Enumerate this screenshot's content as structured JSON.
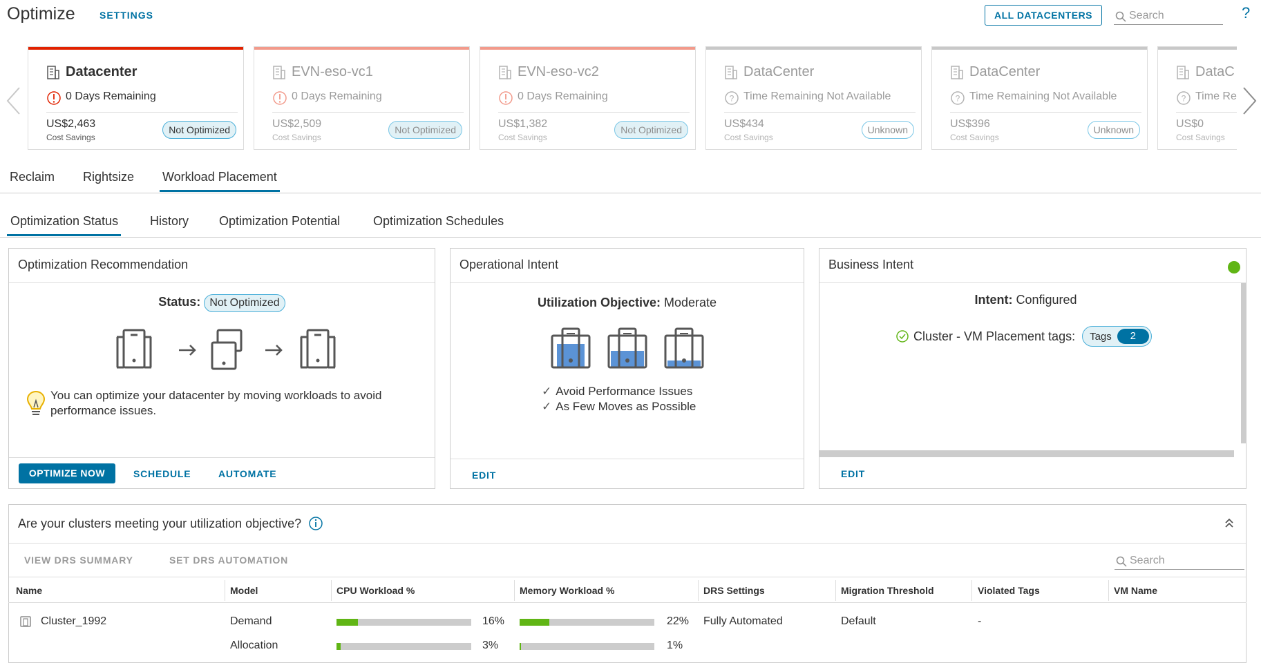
{
  "header": {
    "title": "Optimize",
    "settings_label": "SETTINGS",
    "all_datacenters_label": "ALL DATACENTERS",
    "search_placeholder": "Search",
    "help_label": "?"
  },
  "carousel": {
    "cards": [
      {
        "name": "Datacenter",
        "remaining": "0 Days Remaining",
        "amount": "US$2,463",
        "savings_label": "Cost Savings",
        "badge": "Not Optimized",
        "state": "active",
        "alert": "error"
      },
      {
        "name": "EVN-eso-vc1",
        "remaining": "0 Days Remaining",
        "amount": "US$2,509",
        "savings_label": "Cost Savings",
        "badge": "Not Optimized",
        "state": "dim",
        "alert": "error"
      },
      {
        "name": "EVN-eso-vc2",
        "remaining": "0 Days Remaining",
        "amount": "US$1,382",
        "savings_label": "Cost Savings",
        "badge": "Not Optimized",
        "state": "dim",
        "alert": "error"
      },
      {
        "name": "DataCenter",
        "remaining": "Time Remaining Not Available",
        "amount": "US$434",
        "savings_label": "Cost Savings",
        "badge": "Unknown",
        "state": "dim",
        "alert": "unknown"
      },
      {
        "name": "DataCenter",
        "remaining": "Time Remaining Not Available",
        "amount": "US$396",
        "savings_label": "Cost Savings",
        "badge": "Unknown",
        "state": "dim",
        "alert": "unknown"
      },
      {
        "name": "DataC",
        "remaining": "Time Re",
        "amount": "US$0",
        "savings_label": "Cost Savings",
        "badge": "",
        "state": "dim",
        "alert": "unknown"
      }
    ]
  },
  "tabs": [
    "Reclaim",
    "Rightsize",
    "Workload Placement"
  ],
  "subtabs": [
    "Optimization Status",
    "History",
    "Optimization Potential",
    "Optimization Schedules"
  ],
  "recommendation": {
    "title": "Optimization Recommendation",
    "status_label": "Status:",
    "status_value": "Not Optimized",
    "tip": "You can optimize your datacenter by moving workloads to avoid performance issues.",
    "optimize_now": "OPTIMIZE NOW",
    "schedule": "SCHEDULE",
    "automate": "AUTOMATE"
  },
  "operational": {
    "title": "Operational Intent",
    "objective_label": "Utilization Objective:",
    "objective_value": "Moderate",
    "checks": [
      "Avoid Performance Issues",
      "As Few Moves as Possible"
    ],
    "edit": "EDIT"
  },
  "business": {
    "title": "Business Intent",
    "intent_label": "Intent:",
    "intent_value": "Configured",
    "tags_label": "Cluster - VM Placement tags:",
    "tags_pill": "Tags",
    "tags_count": "2",
    "edit": "EDIT",
    "status_color": "#60b515"
  },
  "clusters": {
    "title": "Are your clusters meeting your utilization objective?",
    "view_drs": "VIEW DRS SUMMARY",
    "set_drs": "SET DRS AUTOMATION",
    "search_placeholder": "Search",
    "columns": [
      "Name",
      "Model",
      "CPU Workload %",
      "Memory Workload %",
      "DRS Settings",
      "Migration Threshold",
      "Violated Tags",
      "VM Name"
    ],
    "rows": [
      {
        "name": "Cluster_1992",
        "model": "Demand",
        "cpu": "16%",
        "cpu_value": 16,
        "mem": "22%",
        "mem_value": 22,
        "drs": "Fully Automated",
        "threshold": "Default",
        "violated": "-",
        "vm": ""
      },
      {
        "name": "",
        "model": "Allocation",
        "cpu": "3%",
        "cpu_value": 3,
        "mem": "1%",
        "mem_value": 1,
        "drs": "",
        "threshold": "",
        "violated": "",
        "vm": ""
      }
    ]
  },
  "colors": {
    "accent": "#0072a3",
    "critical": "#e12200",
    "bar_fill": "#60b515",
    "server_fill": "#5b93d6"
  }
}
